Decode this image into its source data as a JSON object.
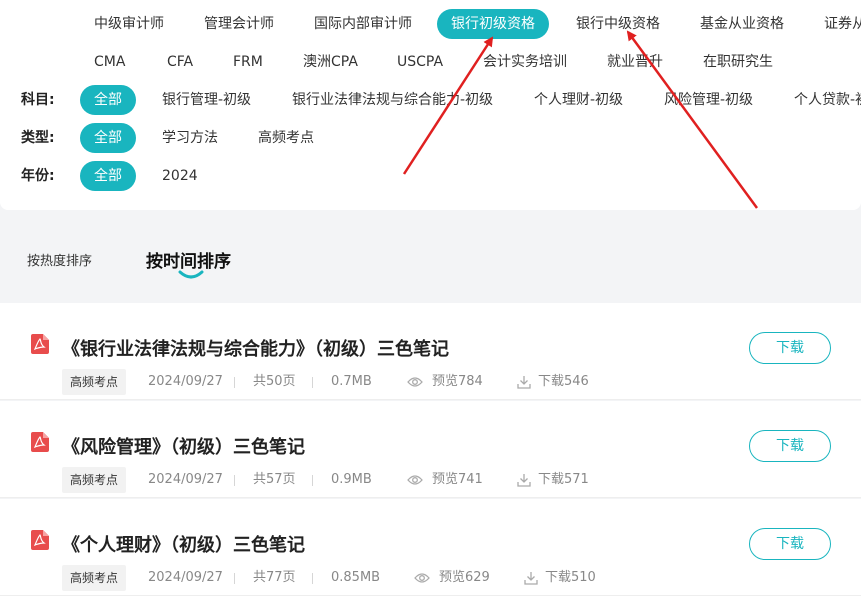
{
  "categories_row1": [
    "中级审计师",
    "管理会计师",
    "国际内部审计师",
    "银行初级资格",
    "银行中级资格",
    "基金从业资格",
    "证券从"
  ],
  "categories_row2": [
    "CMA",
    "CFA",
    "FRM",
    "澳洲CPA",
    "USCPA",
    "会计实务培训",
    "就业晋升",
    "在职研究生"
  ],
  "active_category": "银行初级资格",
  "subject": {
    "label": "科目:",
    "options": [
      "全部",
      "银行管理-初级",
      "银行业法律法规与综合能力-初级",
      "个人理财-初级",
      "风险管理-初级",
      "个人贷款-初"
    ]
  },
  "type": {
    "label": "类型:",
    "options": [
      "全部",
      "学习方法",
      "高频考点"
    ]
  },
  "year": {
    "label": "年份:",
    "options": [
      "全部",
      "2024"
    ]
  },
  "sort": {
    "hot": "按热度排序",
    "time": "按时间排序"
  },
  "items": [
    {
      "title": "《银行业法律法规与综合能力》（初级）三色笔记",
      "tag": "高频考点",
      "date": "2024/09/27",
      "pages": "共50页",
      "size": "0.7MB",
      "views": "预览784",
      "downloads": "下载546",
      "button": "下载"
    },
    {
      "title": "《风险管理》（初级）三色笔记",
      "tag": "高频考点",
      "date": "2024/09/27",
      "pages": "共57页",
      "size": "0.9MB",
      "views": "预览741",
      "downloads": "下载571",
      "button": "下载"
    },
    {
      "title": "《个人理财》（初级）三色笔记",
      "tag": "高频考点",
      "date": "2024/09/27",
      "pages": "共77页",
      "size": "0.85MB",
      "views": "预览629",
      "downloads": "下载510",
      "button": "下载"
    }
  ],
  "colors": {
    "accent": "#19b5bf",
    "pdf": "#e84c4c",
    "annotation_arrow": "#e02020"
  },
  "icons": {
    "file": "pdf-icon",
    "views": "eye-icon",
    "downloads": "download-icon"
  }
}
